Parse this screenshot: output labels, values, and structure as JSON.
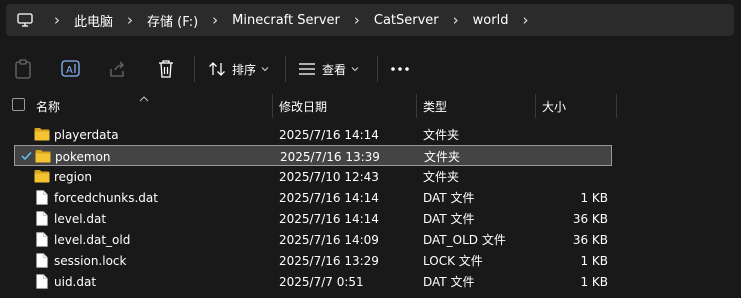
{
  "address_bar": {
    "pc_icon": "monitor-icon",
    "crumbs": [
      "此电脑",
      "存储 (F:)",
      "Minecraft Server",
      "CatServer",
      "world"
    ]
  },
  "toolbar": {
    "icons": [
      "paste-icon",
      "rename-icon",
      "share-icon",
      "delete-icon",
      "sort-icon",
      "view-icon",
      "more-icon"
    ],
    "sort_label": "排序",
    "view_label": "查看",
    "more_label": "···"
  },
  "columns": {
    "name": "名称",
    "modified": "修改日期",
    "type": "类型",
    "size": "大小"
  },
  "files": [
    {
      "name": "playerdata",
      "modified": "2025/7/16 14:14",
      "type": "文件夹",
      "size": "",
      "icon": "folder-icon",
      "selected": false
    },
    {
      "name": "pokemon",
      "modified": "2025/7/16 13:39",
      "type": "文件夹",
      "size": "",
      "icon": "folder-icon",
      "selected": true
    },
    {
      "name": "region",
      "modified": "2025/7/10 12:43",
      "type": "文件夹",
      "size": "",
      "icon": "folder-icon",
      "selected": false
    },
    {
      "name": "forcedchunks.dat",
      "modified": "2025/7/16 14:14",
      "type": "DAT 文件",
      "size": "1 KB",
      "icon": "file-icon",
      "selected": false
    },
    {
      "name": "level.dat",
      "modified": "2025/7/16 14:14",
      "type": "DAT 文件",
      "size": "36 KB",
      "icon": "file-icon",
      "selected": false
    },
    {
      "name": "level.dat_old",
      "modified": "2025/7/16 14:09",
      "type": "DAT_OLD 文件",
      "size": "36 KB",
      "icon": "file-icon",
      "selected": false
    },
    {
      "name": "session.lock",
      "modified": "2025/7/16 13:29",
      "type": "LOCK 文件",
      "size": "1 KB",
      "icon": "file-icon",
      "selected": false
    },
    {
      "name": "uid.dat",
      "modified": "2025/7/7 0:51",
      "type": "DAT 文件",
      "size": "1 KB",
      "icon": "file-icon",
      "selected": false
    }
  ],
  "colors": {
    "background": "#191919",
    "address_bar": "#2b2b2b",
    "selection": "#444444",
    "folder": "#f4c430",
    "text": "#ffffff",
    "check": "#60cdff"
  }
}
